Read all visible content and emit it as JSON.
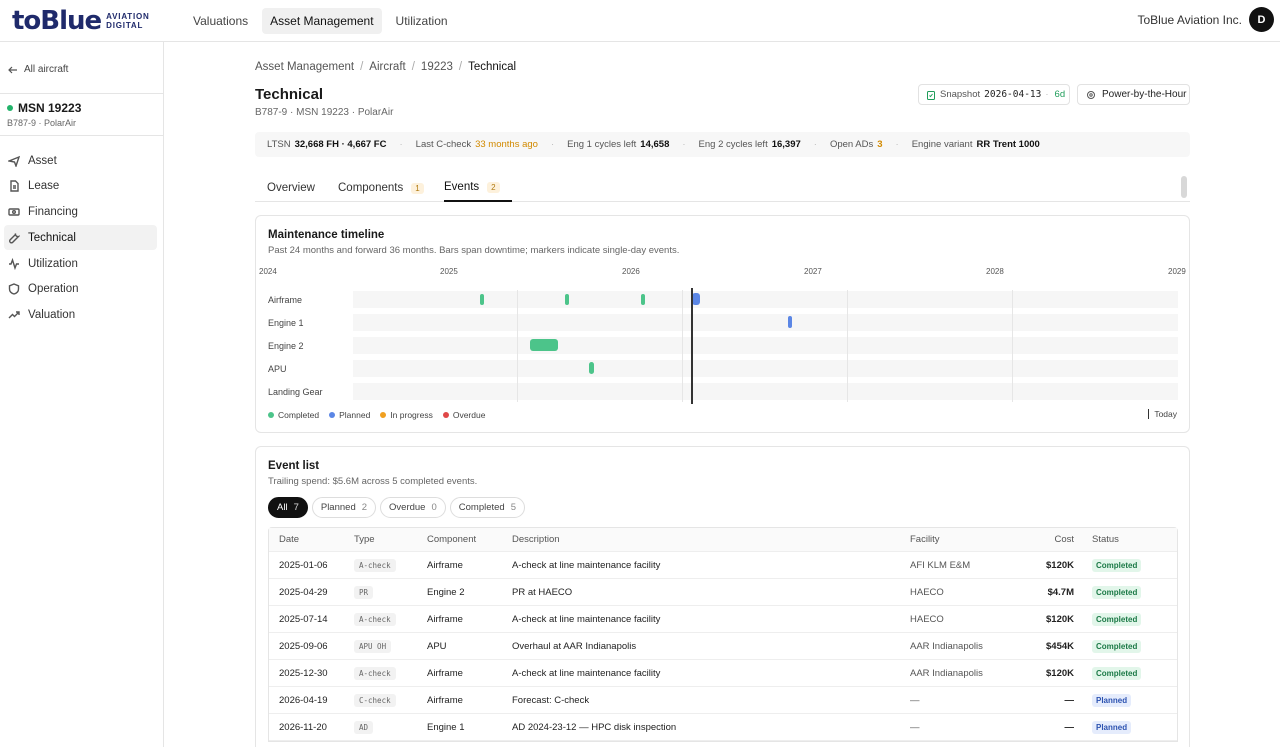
{
  "brand": {
    "logo": "toBlue",
    "sub1": "AVIATION",
    "sub2": "DIGITAL"
  },
  "nav": {
    "items": [
      "Valuations",
      "Asset Management",
      "Utilization"
    ],
    "active": "Asset Management"
  },
  "org": {
    "name": "ToBlue Aviation Inc.",
    "avatar": "D"
  },
  "sidebar": {
    "back_label": "All aircraft",
    "msn": "MSN 19223",
    "msn_sub": "B787-9 · PolarAir",
    "items": [
      {
        "label": "Asset",
        "icon": "plane-icon"
      },
      {
        "label": "Lease",
        "icon": "document-icon"
      },
      {
        "label": "Financing",
        "icon": "banknote-icon"
      },
      {
        "label": "Technical",
        "icon": "wrench-icon"
      },
      {
        "label": "Utilization",
        "icon": "activity-icon"
      },
      {
        "label": "Operation",
        "icon": "shield-icon"
      },
      {
        "label": "Valuation",
        "icon": "trending-up-icon"
      }
    ],
    "active": "Technical"
  },
  "breadcrumb": [
    "Asset Management",
    "Aircraft",
    "19223",
    "Technical"
  ],
  "page": {
    "title": "Technical",
    "subtitle": "B787-9 · MSN 19223 · PolarAir"
  },
  "snapshot": {
    "label": "Snapshot",
    "date": "2026-04-13",
    "age": "6d"
  },
  "pbh_button": "Power-by-the-Hour",
  "stats": {
    "ltsn_label": "LTSN",
    "ltsn_value": "32,668 FH · 4,667 FC",
    "ccheck_label": "Last C-check",
    "ccheck_value": "33 months ago",
    "eng1_label": "Eng 1 cycles left",
    "eng1_value": "14,658",
    "eng2_label": "Eng 2 cycles left",
    "eng2_value": "16,397",
    "ads_label": "Open ADs",
    "ads_value": "3",
    "variant_label": "Engine variant",
    "variant_value": "RR Trent 1000"
  },
  "tabs": [
    {
      "label": "Overview",
      "count": ""
    },
    {
      "label": "Components",
      "count": "1"
    },
    {
      "label": "Events",
      "count": "2"
    }
  ],
  "timeline": {
    "title": "Maintenance timeline",
    "subtitle": "Past 24 months and forward 36 months. Bars span downtime; markers indicate single-day events.",
    "years": [
      "2024",
      "2025",
      "2026",
      "2027",
      "2028",
      "2029"
    ],
    "rows": [
      "Airframe",
      "Engine 1",
      "Engine 2",
      "APU",
      "Landing Gear"
    ],
    "legend": [
      "Completed",
      "Planned",
      "In progress",
      "Overdue"
    ],
    "legend_colors": [
      "#4cc48a",
      "#5b86e5",
      "#f0a020",
      "#e04848"
    ],
    "today_label": "Today"
  },
  "events": {
    "title": "Event list",
    "subtitle": "Trailing spend: $5.6M across 5 completed events.",
    "filters": [
      {
        "label": "All",
        "count": "7"
      },
      {
        "label": "Planned",
        "count": "2"
      },
      {
        "label": "Overdue",
        "count": "0"
      },
      {
        "label": "Completed",
        "count": "5"
      }
    ],
    "columns": [
      "Date",
      "Type",
      "Component",
      "Description",
      "Facility",
      "Cost",
      "Status"
    ],
    "rows": [
      [
        "2025-01-06",
        "A-check",
        "Airframe",
        "A-check at line maintenance facility",
        "AFI KLM E&M",
        "$120K",
        "Completed"
      ],
      [
        "2025-04-29",
        "PR",
        "Engine 2",
        "PR at HAECO",
        "HAECO",
        "$4.7M",
        "Completed"
      ],
      [
        "2025-07-14",
        "A-check",
        "Airframe",
        "A-check at line maintenance facility",
        "HAECO",
        "$120K",
        "Completed"
      ],
      [
        "2025-09-06",
        "APU OH",
        "APU",
        "Overhaul at AAR Indianapolis",
        "AAR Indianapolis",
        "$454K",
        "Completed"
      ],
      [
        "2025-12-30",
        "A-check",
        "Airframe",
        "A-check at line maintenance facility",
        "AAR Indianapolis",
        "$120K",
        "Completed"
      ],
      [
        "2026-04-19",
        "C-check",
        "Airframe",
        "Forecast: C-check",
        "—",
        "—",
        "Planned"
      ],
      [
        "2026-11-20",
        "AD",
        "Engine 1",
        "AD 2024-23-12 — HPC disk inspection",
        "—",
        "—",
        "Planned"
      ]
    ]
  }
}
